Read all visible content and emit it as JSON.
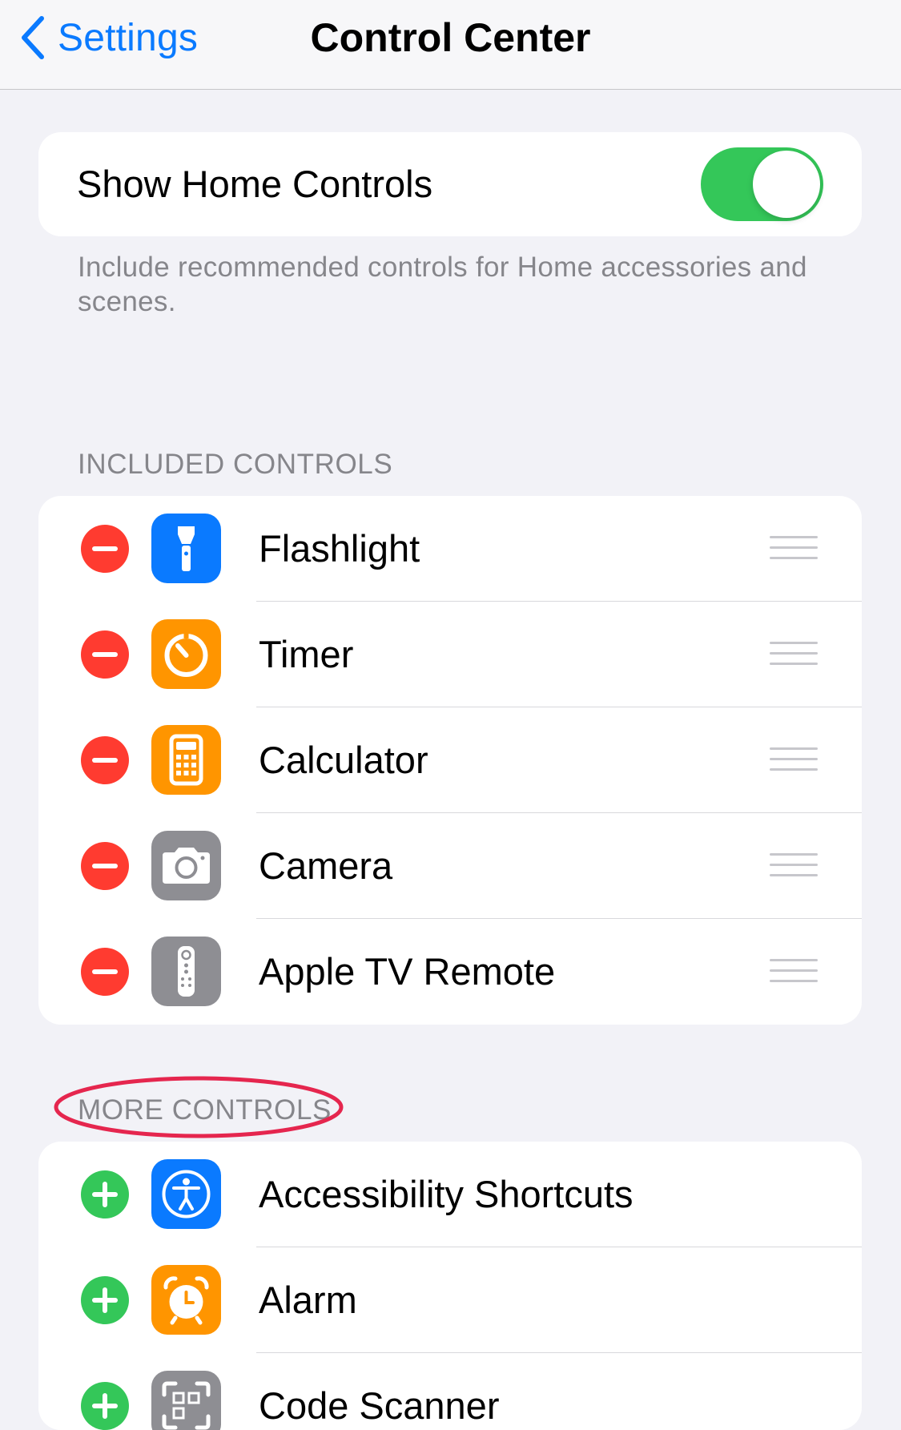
{
  "nav": {
    "back_label": "Settings",
    "title": "Control Center"
  },
  "home_controls": {
    "label": "Show Home Controls",
    "enabled": true,
    "footnote": "Include recommended controls for Home accessories and scenes."
  },
  "included": {
    "header": "INCLUDED CONTROLS",
    "items": [
      {
        "label": "Flashlight",
        "icon": "flashlight-icon",
        "color": "#0a7aff"
      },
      {
        "label": "Timer",
        "icon": "timer-icon",
        "color": "#ff9500"
      },
      {
        "label": "Calculator",
        "icon": "calculator-icon",
        "color": "#ff9500"
      },
      {
        "label": "Camera",
        "icon": "camera-icon",
        "color": "#8e8e93"
      },
      {
        "label": "Apple TV Remote",
        "icon": "remote-icon",
        "color": "#8e8e93"
      }
    ]
  },
  "more": {
    "header": "MORE CONTROLS",
    "items": [
      {
        "label": "Accessibility Shortcuts",
        "icon": "accessibility-icon",
        "color": "#0a7aff"
      },
      {
        "label": "Alarm",
        "icon": "alarm-icon",
        "color": "#ff9500"
      },
      {
        "label": "Code Scanner",
        "icon": "qr-code-icon",
        "color": "#8e8e93"
      }
    ]
  },
  "colors": {
    "accent": "#0a7aff",
    "remove": "#ff3b30",
    "add": "#34c759",
    "annotation": "#e5264e"
  }
}
